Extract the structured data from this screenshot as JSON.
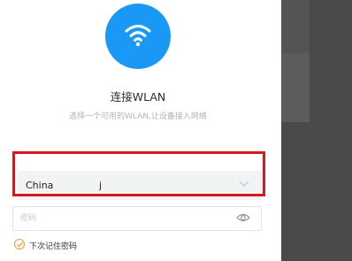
{
  "header": {
    "title": "连接WLAN",
    "subtitle": "选择一个可用的WLAN,让设备接入网络",
    "icon": "wifi-icon",
    "icon_color": "#1a98f5"
  },
  "network_select": {
    "value": "China",
    "cursor_text": "j",
    "icon": "chevron-down-icon"
  },
  "password": {
    "placeholder": "密码",
    "value": "",
    "icon": "eye-icon"
  },
  "remember": {
    "label": "下次记住密码",
    "checked": true,
    "color": "#f09a3e"
  },
  "highlight_color": "#d8191c"
}
